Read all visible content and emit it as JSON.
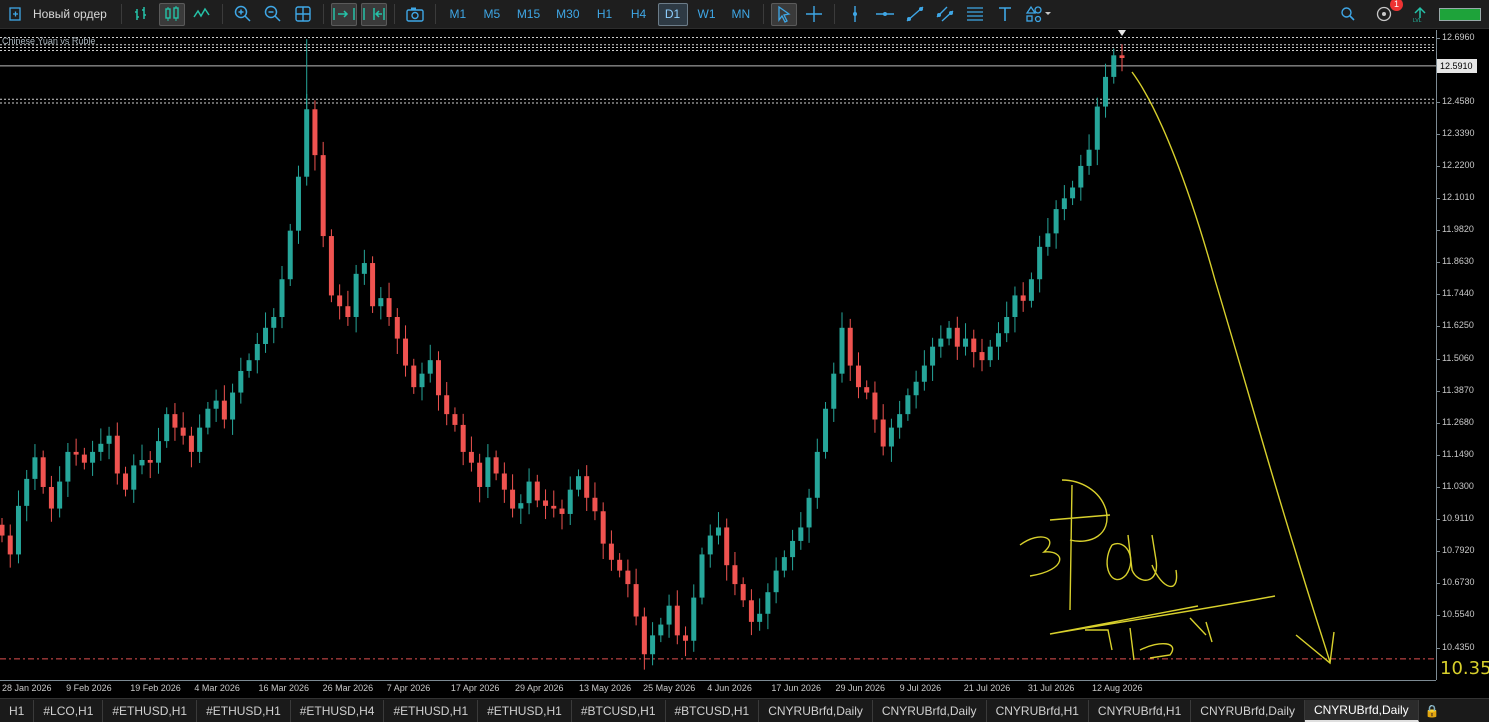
{
  "toolbar": {
    "new_order_label": "Новый ордер",
    "timeframes": [
      "M1",
      "M5",
      "M15",
      "M30",
      "H1",
      "H4",
      "D1",
      "W1",
      "MN"
    ],
    "active_timeframe": "D1",
    "notification_count": "1",
    "icons": [
      "candles-chart-icon",
      "bar-chart-icon",
      "line-chart-icon",
      "zoom-in-icon",
      "zoom-out-icon",
      "grid-icon",
      "autoscroll-icon",
      "chart-shift-icon",
      "screenshot-icon",
      "cursor-icon",
      "crosshair-icon",
      "vertical-line-icon",
      "horizontal-line-icon",
      "trendline-icon",
      "channel-icon",
      "fibonacci-icon",
      "text-icon",
      "shapes-icon",
      "search-icon",
      "notification-icon",
      "level-icon"
    ]
  },
  "chart": {
    "symbol_description": "Chinese Yuan vs Ruble",
    "current_price": "12.5910",
    "price_ticks": [
      "12.6960",
      "12.5910",
      "12.4580",
      "12.3390",
      "12.2200",
      "12.1010",
      "11.9820",
      "11.8630",
      "11.7440",
      "11.6250",
      "11.5060",
      "11.3870",
      "11.2680",
      "11.1490",
      "11.0300",
      "10.9110",
      "10.7920",
      "10.6730",
      "10.5540",
      "10.4350"
    ],
    "time_ticks": [
      "28 Jan 2026",
      "9 Feb 2026",
      "19 Feb 2026",
      "4 Mar 2026",
      "16 Mar 2026",
      "26 Mar 2026",
      "7 Apr 2026",
      "17 Apr 2026",
      "29 Apr 2026",
      "13 May 2026",
      "25 May 2026",
      "4 Jun 2026",
      "17 Jun 2026",
      "29 Jun 2026",
      "9 Jul 2026",
      "21 Jul 2026",
      "31 Jul 2026",
      "12 Aug 2026"
    ],
    "annotation_level": "10.35",
    "colors": {
      "bull": "#26a69a",
      "bear": "#ef5350",
      "drawing": "#d8d02c",
      "dashed_level": "#cfcfcf",
      "bottom_level": "#e05050"
    }
  },
  "chart_data": {
    "type": "candlestick",
    "series": [
      {
        "name": "CNYRUBrfd",
        "close": [
          10.85,
          10.78,
          10.96,
          11.06,
          11.14,
          11.03,
          10.95,
          11.05,
          11.16,
          11.15,
          11.12,
          11.16,
          11.19,
          11.22,
          11.08,
          11.02,
          11.11,
          11.13,
          11.12,
          11.2,
          11.3,
          11.25,
          11.22,
          11.16,
          11.25,
          11.32,
          11.35,
          11.28,
          11.38,
          11.46,
          11.5,
          11.56,
          11.62,
          11.66,
          11.8,
          11.98,
          12.18,
          12.43,
          12.26,
          11.96,
          11.74,
          11.7,
          11.66,
          11.82,
          11.86,
          11.7,
          11.73,
          11.66,
          11.58,
          11.48,
          11.4,
          11.45,
          11.5,
          11.37,
          11.3,
          11.26,
          11.16,
          11.12,
          11.03,
          11.14,
          11.08,
          11.02,
          10.95,
          10.97,
          11.05,
          10.98,
          10.96,
          10.95,
          10.93,
          11.02,
          11.07,
          10.99,
          10.94,
          10.82,
          10.76,
          10.72,
          10.67,
          10.55,
          10.41,
          10.48,
          10.52,
          10.59,
          10.48,
          10.46,
          10.62,
          10.78,
          10.85,
          10.88,
          10.74,
          10.67,
          10.61,
          10.53,
          10.56,
          10.64,
          10.72,
          10.77,
          10.83,
          10.88,
          10.99,
          11.16,
          11.32,
          11.45,
          11.62,
          11.48,
          11.4,
          11.38,
          11.28,
          11.18,
          11.25,
          11.3,
          11.37,
          11.42,
          11.48,
          11.55,
          11.58,
          11.62,
          11.55,
          11.58,
          11.53,
          11.5,
          11.55,
          11.6,
          11.66,
          11.74,
          11.72,
          11.8,
          11.92,
          11.97,
          12.06,
          12.1,
          12.14,
          12.22,
          12.28,
          12.44,
          12.55,
          12.63,
          12.62
        ]
      }
    ],
    "ylim": [
      10.39,
      12.72
    ],
    "levels": [
      12.696,
      12.669,
      12.659,
      12.648,
      12.467,
      12.453,
      10.393
    ]
  },
  "tabs": [
    "H1",
    "#LCO,H1",
    "#ETHUSD,H1",
    "#ETHUSD,H1",
    "#ETHUSD,H4",
    "#ETHUSD,H1",
    "#ETHUSD,H1",
    "#BTCUSD,H1",
    "#BTCUSD,H1",
    "CNYRUBrfd,Daily",
    "CNYRUBrfd,Daily",
    "CNYRUBrfd,H1",
    "CNYRUBrfd,H1",
    "CNYRUBrfd,Daily",
    "CNYRUBrfd,Daily"
  ],
  "active_tab_index": 14
}
